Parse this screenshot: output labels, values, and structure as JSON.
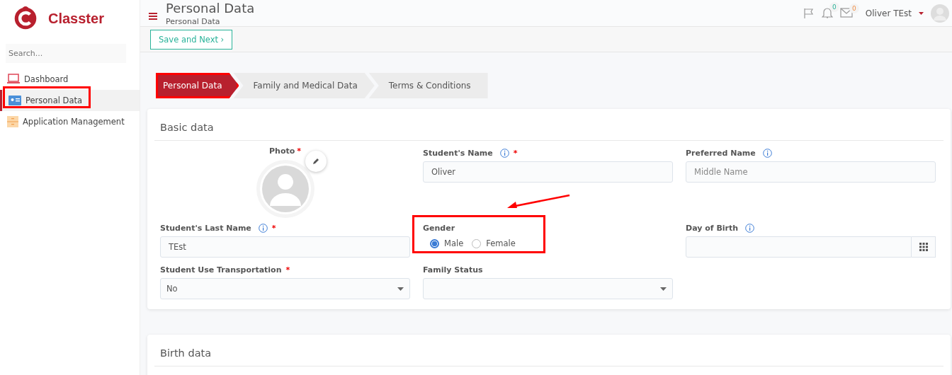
{
  "brand": {
    "name": "Classter"
  },
  "sidebar": {
    "search": {
      "placeholder": "Search..."
    },
    "items": [
      {
        "label": "Dashboard",
        "selected": false
      },
      {
        "label": "Personal Data",
        "selected": true
      },
      {
        "label": "Application Management",
        "selected": false
      }
    ]
  },
  "header": {
    "title": "Personal Data",
    "breadcrumb": "Personal Data",
    "notifications": "0",
    "messages": "0",
    "user": "Oliver TEst"
  },
  "toolbar": {
    "button": "Save and Next",
    "button_icon": "›"
  },
  "steps": [
    {
      "label": "Personal Data",
      "selected": true
    },
    {
      "label": "Family and Medical Data",
      "selected": false
    },
    {
      "label": "Terms & Conditions",
      "selected": false
    }
  ],
  "basic_data": {
    "title": "Basic data",
    "photo": {
      "label": "Photo",
      "required_mark": "*"
    },
    "fields": [
      {
        "kind": "text",
        "label": "Student's Name",
        "info": true,
        "required_mark": "*",
        "value": "Oliver"
      },
      {
        "kind": "text",
        "label": "Preferred Name",
        "info": true,
        "placeholder": "Middle Name"
      },
      {
        "kind": "text",
        "label": "Student's Last Name",
        "info": true,
        "required_mark": "*",
        "value": "TEst"
      },
      {
        "kind": "radio",
        "label": "Gender",
        "info": false,
        "options": [
          {
            "label": "Male",
            "selected": true
          },
          {
            "label": "Female",
            "selected": false
          }
        ]
      },
      {
        "kind": "date",
        "label": "Day of Birth",
        "info": true
      },
      {
        "kind": "select",
        "label": "Student Use Transportation",
        "info": false,
        "required_mark": "*",
        "value": "No"
      },
      {
        "kind": "select",
        "label": "Family Status",
        "info": false
      }
    ]
  },
  "birth_data": {
    "title": "Birth data"
  }
}
